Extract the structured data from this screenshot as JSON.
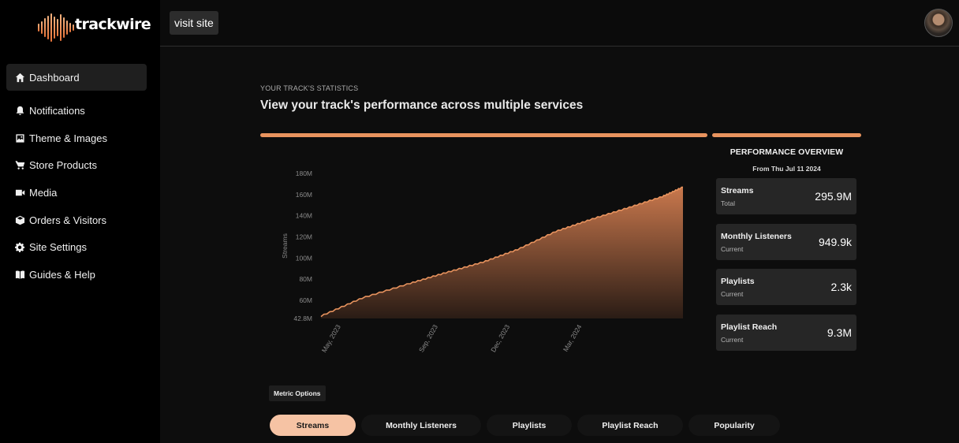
{
  "brand": {
    "name": "trackwire",
    "accent": "#e8935e"
  },
  "header": {
    "visit_site": "visit site"
  },
  "sidebar": {
    "items": [
      {
        "label": "Dashboard",
        "icon": "home-icon",
        "active": true
      },
      {
        "label": "Notifications",
        "icon": "bell-icon"
      },
      {
        "label": "Theme & Images",
        "icon": "image-icon"
      },
      {
        "label": "Store Products",
        "icon": "cart-icon"
      },
      {
        "label": "Media",
        "icon": "video-icon"
      },
      {
        "label": "Orders & Visitors",
        "icon": "box-icon"
      },
      {
        "label": "Site Settings",
        "icon": "gear-icon"
      },
      {
        "label": "Guides & Help",
        "icon": "book-icon"
      }
    ]
  },
  "main": {
    "overline": "YOUR TRACK'S STATISTICS",
    "title": "View your track's performance across multiple services"
  },
  "performance": {
    "title": "PERFORMANCE OVERVIEW",
    "subtitle": "From Thu Jul 11 2024",
    "cards": [
      {
        "label": "Streams",
        "sub": "Total",
        "value": "295.9M"
      },
      {
        "label": "Monthly Listeners",
        "sub": "Current",
        "value": "949.9k"
      },
      {
        "label": "Playlists",
        "sub": "Current",
        "value": "2.3k"
      },
      {
        "label": "Playlist Reach",
        "sub": "Current",
        "value": "9.3M"
      }
    ]
  },
  "chart_data": {
    "type": "area",
    "ylabel": "Streams",
    "y_ticks": [
      "42.8M",
      "60M",
      "80M",
      "100M",
      "120M",
      "140M",
      "160M",
      "180M"
    ],
    "ylim": [
      42.8,
      180
    ],
    "x_ticks": [
      "May, 2023",
      "Sep, 2023",
      "Dec, 2023",
      "Mar, 2024"
    ],
    "x_tick_dates": [
      "2023-05-01",
      "2023-09-01",
      "2023-12-01",
      "2024-03-01"
    ],
    "series": [
      {
        "color": "#e8935e",
        "points": [
          [
            "2023-04-10",
            45
          ],
          [
            "2023-06-01",
            62
          ],
          [
            "2023-08-01",
            76
          ],
          [
            "2023-09-15",
            86
          ],
          [
            "2023-11-01",
            96
          ],
          [
            "2023-12-15",
            108
          ],
          [
            "2024-02-01",
            125
          ],
          [
            "2024-03-15",
            136
          ],
          [
            "2024-05-01",
            147
          ],
          [
            "2024-06-15",
            158
          ],
          [
            "2024-07-11",
            167
          ]
        ]
      }
    ]
  },
  "metric_options": {
    "label": "Metric Options",
    "options": [
      "Streams",
      "Monthly Listeners",
      "Playlists",
      "Playlist Reach",
      "Popularity"
    ],
    "selected": "Streams"
  }
}
